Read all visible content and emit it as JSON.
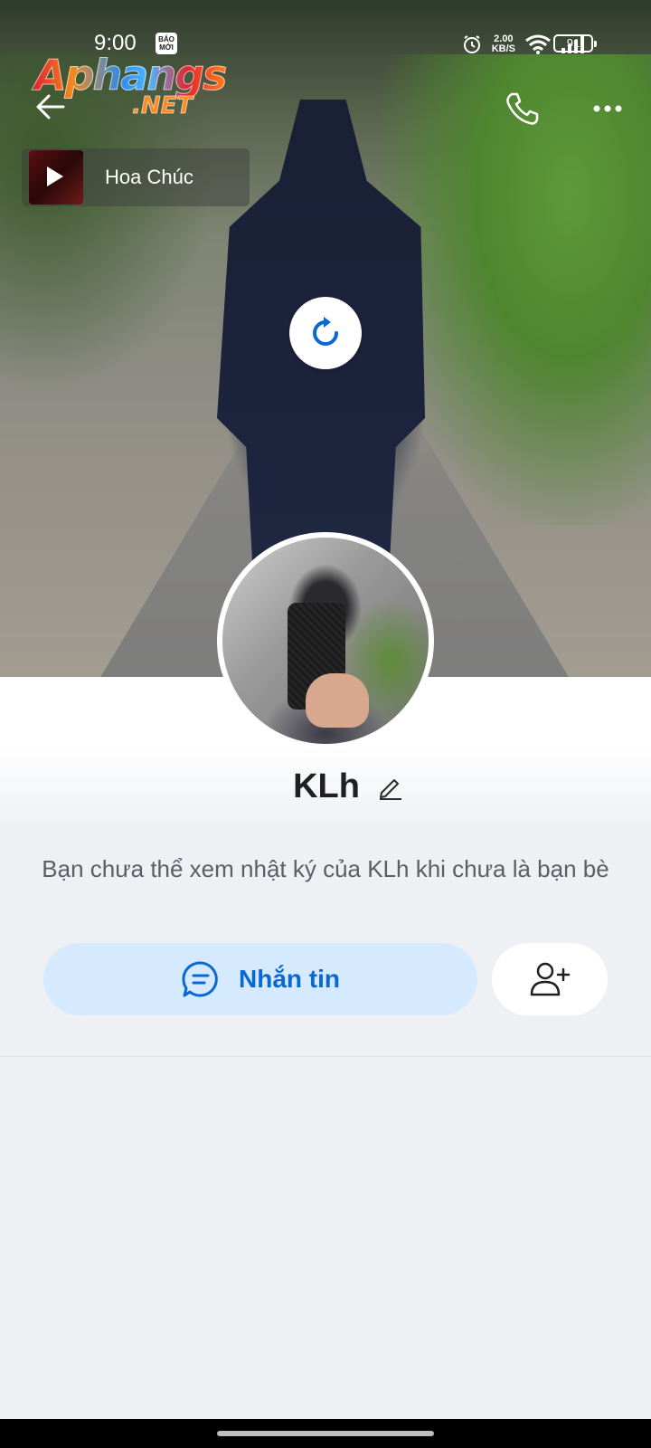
{
  "status_bar": {
    "time": "9:00",
    "notification_icon": "baomoi-icon",
    "notification_text": "BÁO MỚI",
    "net_speed_value": "2.00",
    "net_speed_unit": "KB/S",
    "battery": "91",
    "icons": [
      "alarm-icon",
      "wifi-icon",
      "signal-icon",
      "battery-icon"
    ]
  },
  "watermark": {
    "main": "Aphangs",
    "sub": ".NET"
  },
  "nav": {
    "back_icon": "back-arrow-icon",
    "call_icon": "phone-icon",
    "more_icon": "more-dots-icon"
  },
  "music": {
    "title": "Hoa Chúc",
    "icon": "play-icon"
  },
  "cover": {
    "refresh_icon": "refresh-icon"
  },
  "profile": {
    "name": "KLh",
    "privacy_note": "Bạn chưa thể xem nhật ký của KLh khi chưa là bạn bè"
  },
  "actions": {
    "message_label": "Nhắn tin",
    "message_icon": "chat-bubble-icon",
    "add_friend_icon": "add-friend-icon"
  },
  "colors": {
    "accent": "#0a68d4",
    "message_bg": "#d5e9ff",
    "page_bg": "#eef0f3"
  }
}
